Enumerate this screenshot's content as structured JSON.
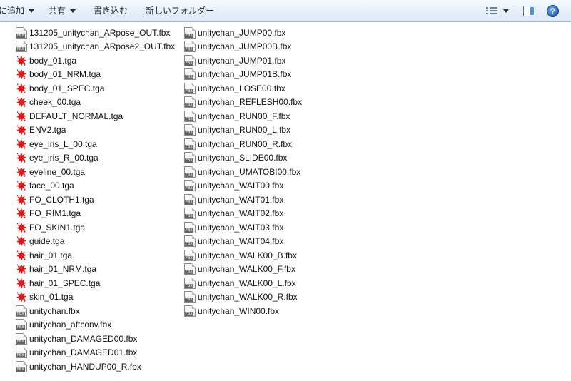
{
  "toolbar": {
    "add_label": "に追加",
    "share_label": "共有",
    "burn_label": "書き込む",
    "new_folder_label": "新しいフォルダー",
    "help_glyph": "?"
  },
  "files": {
    "column1": [
      {
        "name": "131205_unitychan_ARpose_OUT.fbx",
        "icon": "fbx-file-icon"
      },
      {
        "name": "131205_unitychan_ARpose2_OUT.fbx",
        "icon": "fbx-file-icon"
      },
      {
        "name": "body_01.tga",
        "icon": "tga-file-icon"
      },
      {
        "name": "body_01_NRM.tga",
        "icon": "tga-file-icon"
      },
      {
        "name": "body_01_SPEC.tga",
        "icon": "tga-file-icon"
      },
      {
        "name": "cheek_00.tga",
        "icon": "tga-file-icon"
      },
      {
        "name": "DEFAULT_NORMAL.tga",
        "icon": "tga-file-icon"
      },
      {
        "name": "ENV2.tga",
        "icon": "tga-file-icon"
      },
      {
        "name": "eye_iris_L_00.tga",
        "icon": "tga-file-icon"
      },
      {
        "name": "eye_iris_R_00.tga",
        "icon": "tga-file-icon"
      },
      {
        "name": "eyeline_00.tga",
        "icon": "tga-file-icon"
      },
      {
        "name": "face_00.tga",
        "icon": "tga-file-icon"
      },
      {
        "name": "FO_CLOTH1.tga",
        "icon": "tga-file-icon"
      },
      {
        "name": "FO_RIM1.tga",
        "icon": "tga-file-icon"
      },
      {
        "name": "FO_SKIN1.tga",
        "icon": "tga-file-icon"
      },
      {
        "name": "guide.tga",
        "icon": "tga-file-icon"
      },
      {
        "name": "hair_01.tga",
        "icon": "tga-file-icon"
      },
      {
        "name": "hair_01_NRM.tga",
        "icon": "tga-file-icon"
      },
      {
        "name": "hair_01_SPEC.tga",
        "icon": "tga-file-icon"
      },
      {
        "name": "skin_01.tga",
        "icon": "tga-file-icon"
      },
      {
        "name": "unitychan.fbx",
        "icon": "fbx-file-icon"
      },
      {
        "name": "unitychan_aftconv.fbx",
        "icon": "fbx-file-icon"
      },
      {
        "name": "unitychan_DAMAGED00.fbx",
        "icon": "fbx-file-icon"
      },
      {
        "name": "unitychan_DAMAGED01.fbx",
        "icon": "fbx-file-icon"
      },
      {
        "name": "unitychan_HANDUP00_R.fbx",
        "icon": "fbx-file-icon"
      }
    ],
    "column2": [
      {
        "name": "unitychan_JUMP00.fbx",
        "icon": "fbx-file-icon"
      },
      {
        "name": "unitychan_JUMP00B.fbx",
        "icon": "fbx-file-icon"
      },
      {
        "name": "unitychan_JUMP01.fbx",
        "icon": "fbx-file-icon"
      },
      {
        "name": "unitychan_JUMP01B.fbx",
        "icon": "fbx-file-icon"
      },
      {
        "name": "unitychan_LOSE00.fbx",
        "icon": "fbx-file-icon"
      },
      {
        "name": "unitychan_REFLESH00.fbx",
        "icon": "fbx-file-icon"
      },
      {
        "name": "unitychan_RUN00_F.fbx",
        "icon": "fbx-file-icon"
      },
      {
        "name": "unitychan_RUN00_L.fbx",
        "icon": "fbx-file-icon"
      },
      {
        "name": "unitychan_RUN00_R.fbx",
        "icon": "fbx-file-icon"
      },
      {
        "name": "unitychan_SLIDE00.fbx",
        "icon": "fbx-file-icon"
      },
      {
        "name": "unitychan_UMATOBI00.fbx",
        "icon": "fbx-file-icon"
      },
      {
        "name": "unitychan_WAIT00.fbx",
        "icon": "fbx-file-icon"
      },
      {
        "name": "unitychan_WAIT01.fbx",
        "icon": "fbx-file-icon"
      },
      {
        "name": "unitychan_WAIT02.fbx",
        "icon": "fbx-file-icon"
      },
      {
        "name": "unitychan_WAIT03.fbx",
        "icon": "fbx-file-icon"
      },
      {
        "name": "unitychan_WAIT04.fbx",
        "icon": "fbx-file-icon"
      },
      {
        "name": "unitychan_WALK00_B.fbx",
        "icon": "fbx-file-icon"
      },
      {
        "name": "unitychan_WALK00_F.fbx",
        "icon": "fbx-file-icon"
      },
      {
        "name": "unitychan_WALK00_L.fbx",
        "icon": "fbx-file-icon"
      },
      {
        "name": "unitychan_WALK00_R.fbx",
        "icon": "fbx-file-icon"
      },
      {
        "name": "unitychan_WIN00.fbx",
        "icon": "fbx-file-icon"
      }
    ]
  },
  "colors": {
    "toolbar_top": "#f7fbff",
    "toolbar_bottom": "#dce7f5",
    "tga_icon_red": "#e01818"
  }
}
